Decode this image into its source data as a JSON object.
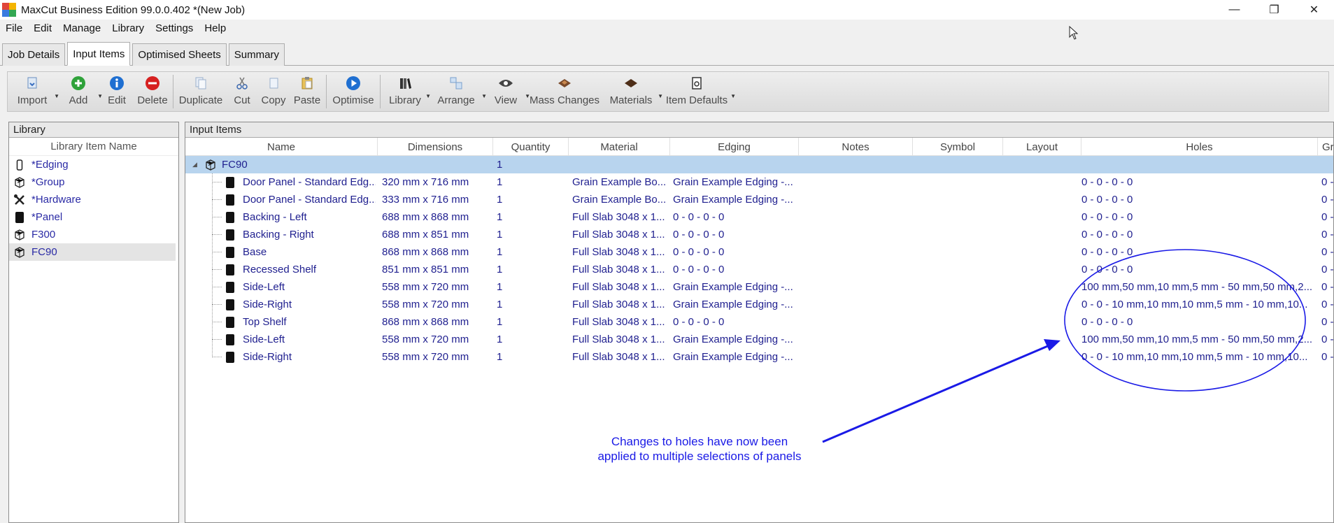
{
  "window": {
    "title": "MaxCut Business Edition 99.0.0.402 *(New Job)",
    "controls": [
      "—",
      "❐",
      "✕"
    ]
  },
  "menu": [
    "File",
    "Edit",
    "Manage",
    "Library",
    "Settings",
    "Help"
  ],
  "tabs": [
    {
      "label": "Job Details",
      "active": false
    },
    {
      "label": "Input Items",
      "active": true
    },
    {
      "label": "Optimised Sheets",
      "active": false
    },
    {
      "label": "Summary",
      "active": false
    }
  ],
  "toolbar": {
    "import": "Import",
    "add": "Add",
    "edit": "Edit",
    "delete": "Delete",
    "duplicate": "Duplicate",
    "cut": "Cut",
    "copy": "Copy",
    "paste": "Paste",
    "optimise": "Optimise",
    "library": "Library",
    "arrange": "Arrange",
    "view": "View",
    "mass_changes": "Mass Changes",
    "materials": "Materials",
    "item_defaults": "Item Defaults"
  },
  "library": {
    "header": "Library",
    "column": "Library Item Name",
    "items": [
      {
        "label": "*Edging",
        "icon": "edging-icon"
      },
      {
        "label": "*Group",
        "icon": "group-icon"
      },
      {
        "label": "*Hardware",
        "icon": "hardware-icon"
      },
      {
        "label": "*Panel",
        "icon": "panel-icon"
      },
      {
        "label": "F300",
        "icon": "group-icon"
      },
      {
        "label": "FC90",
        "icon": "group-icon",
        "selected": true
      }
    ]
  },
  "input_items": {
    "header": "Input Items",
    "columns": [
      "Name",
      "Dimensions",
      "Quantity",
      "Material",
      "Edging",
      "Notes",
      "Symbol",
      "Layout",
      "Holes",
      "Gro"
    ],
    "group": {
      "name": "FC90",
      "quantity": "1",
      "expander": "◢"
    },
    "rows": [
      {
        "name": "Door Panel - Standard Edg...",
        "dimensions": "320 mm x 716 mm",
        "quantity": "1",
        "material": "Grain Example Bo...",
        "edging": "Grain Example Edging -...",
        "holes": "0 - 0 - 0 - 0",
        "gro": "0 -"
      },
      {
        "name": "Door Panel - Standard Edg...",
        "dimensions": "333 mm x 716 mm",
        "quantity": "1",
        "material": "Grain Example Bo...",
        "edging": "Grain Example Edging -...",
        "holes": "0 - 0 - 0 - 0",
        "gro": "0 -"
      },
      {
        "name": "Backing - Left",
        "dimensions": "688 mm x 868 mm",
        "quantity": "1",
        "material": "Full Slab 3048 x 1...",
        "edging": "0 - 0 - 0 - 0",
        "holes": "0 - 0 - 0 - 0",
        "gro": "0 -"
      },
      {
        "name": "Backing - Right",
        "dimensions": "688 mm x 851 mm",
        "quantity": "1",
        "material": "Full Slab 3048 x 1...",
        "edging": "0 - 0 - 0 - 0",
        "holes": "0 - 0 - 0 - 0",
        "gro": "0 -"
      },
      {
        "name": "Base",
        "dimensions": "868 mm x 868 mm",
        "quantity": "1",
        "material": "Full Slab 3048 x 1...",
        "edging": "0 - 0 - 0 - 0",
        "holes": "0 - 0 - 0 - 0",
        "gro": "0 -"
      },
      {
        "name": "Recessed Shelf",
        "dimensions": "851 mm x 851 mm",
        "quantity": "1",
        "material": "Full Slab 3048 x 1...",
        "edging": "0 - 0 - 0 - 0",
        "holes": "0 - 0 - 0 - 0",
        "gro": "0 -"
      },
      {
        "name": "Side-Left",
        "dimensions": "558 mm x 720 mm",
        "quantity": "1",
        "material": "Full Slab 3048 x 1...",
        "edging": "Grain Example Edging -...",
        "holes": "100 mm,50 mm,10 mm,5 mm - 50 mm,50 mm,2...",
        "gro": "0 -"
      },
      {
        "name": "Side-Right",
        "dimensions": "558 mm x 720 mm",
        "quantity": "1",
        "material": "Full Slab 3048 x 1...",
        "edging": "Grain Example Edging -...",
        "holes": "0 - 0 - 10 mm,10 mm,10 mm,5 mm - 10 mm,10...",
        "gro": "0 -"
      },
      {
        "name": "Top Shelf",
        "dimensions": "868 mm x 868 mm",
        "quantity": "1",
        "material": "Full Slab 3048 x 1...",
        "edging": "0 - 0 - 0 - 0",
        "holes": "0 - 0 - 0 - 0",
        "gro": "0 -"
      },
      {
        "name": "Side-Left",
        "dimensions": "558 mm x 720 mm",
        "quantity": "1",
        "material": "Full Slab 3048 x 1...",
        "edging": "Grain Example Edging -...",
        "holes": "100 mm,50 mm,10 mm,5 mm - 50 mm,50 mm,2...",
        "gro": "0 -"
      },
      {
        "name": "Side-Right",
        "dimensions": "558 mm x 720 mm",
        "quantity": "1",
        "material": "Full Slab 3048 x 1...",
        "edging": "Grain Example Edging -...",
        "holes": "0 - 0 - 10 mm,10 mm,10 mm,5 mm - 10 mm,10...",
        "gro": "0 -"
      }
    ]
  },
  "annotation": {
    "line1": "Changes to holes have now been",
    "line2": "applied to multiple selections of panels",
    "color": "#1a1ae6"
  },
  "colors": {
    "text_blue": "#1f1f8f",
    "group_row": "#b8d4ee",
    "annotation": "#1a1ae6"
  }
}
